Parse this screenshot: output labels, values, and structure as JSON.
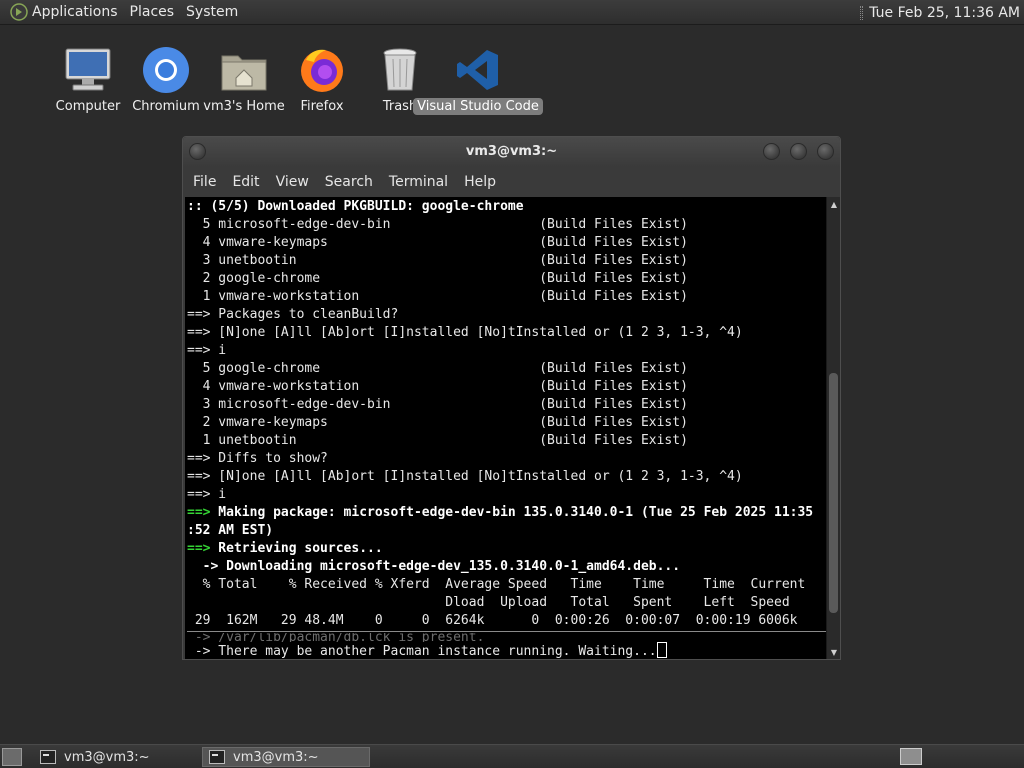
{
  "top_panel": {
    "menus": [
      "Applications",
      "Places",
      "System"
    ],
    "clock": "Tue Feb 25, 11:36 AM"
  },
  "desktop": {
    "icons": [
      {
        "label": "Computer",
        "icon": "computer-icon"
      },
      {
        "label": "Chromium",
        "icon": "chromium-icon"
      },
      {
        "label": "vm3's Home",
        "icon": "home-folder-icon"
      },
      {
        "label": "Firefox",
        "icon": "firefox-icon"
      },
      {
        "label": "Trash",
        "icon": "trash-icon"
      },
      {
        "label": "Visual Studio Code",
        "icon": "vscode-icon",
        "selected": true
      }
    ]
  },
  "terminal": {
    "title": "vm3@vm3:~",
    "menu": [
      "File",
      "Edit",
      "View",
      "Search",
      "Terminal",
      "Help"
    ],
    "lines": [
      ":: (5/5) Downloaded PKGBUILD: google-chrome",
      "  5 microsoft-edge-dev-bin                   (Build Files Exist)",
      "  4 vmware-keymaps                           (Build Files Exist)",
      "  3 unetbootin                               (Build Files Exist)",
      "  2 google-chrome                            (Build Files Exist)",
      "  1 vmware-workstation                       (Build Files Exist)",
      "==> Packages to cleanBuild?",
      "==> [N]one [A]ll [Ab]ort [I]nstalled [No]tInstalled or (1 2 3, 1-3, ^4)",
      "==> i",
      "  5 google-chrome                            (Build Files Exist)",
      "  4 vmware-workstation                       (Build Files Exist)",
      "  3 microsoft-edge-dev-bin                   (Build Files Exist)",
      "  2 vmware-keymaps                           (Build Files Exist)",
      "  1 unetbootin                               (Build Files Exist)",
      "==> Diffs to show?",
      "==> [N]one [A]ll [Ab]ort [I]nstalled [No]tInstalled or (1 2 3, 1-3, ^4)",
      "==> i",
      "==>",
      " Making package: microsoft-edge-dev-bin 135.0.3140.0-1 (Tue 25 Feb 2025 11:35",
      ":52 AM EST)",
      "==>",
      " Retrieving sources...",
      "  -> Downloading microsoft-edge-dev_135.0.3140.0-1_amd64.deb...",
      "  % Total    % Received % Xferd  Average Speed   Time    Time     Time  Current",
      "                                 Dload  Upload   Total   Spent    Left  Speed",
      " 29  162M   29 48.4M    0     0  6264k      0  0:00:26  0:00:07  0:00:19 6006k",
      " -> /var/lib/pacman/db.lck is present.",
      " -> There may be another Pacman instance running. Waiting..."
    ]
  },
  "taskbar": {
    "tasks": [
      {
        "label": "vm3@vm3:~",
        "active": false
      },
      {
        "label": "vm3@vm3:~",
        "active": true
      }
    ]
  }
}
